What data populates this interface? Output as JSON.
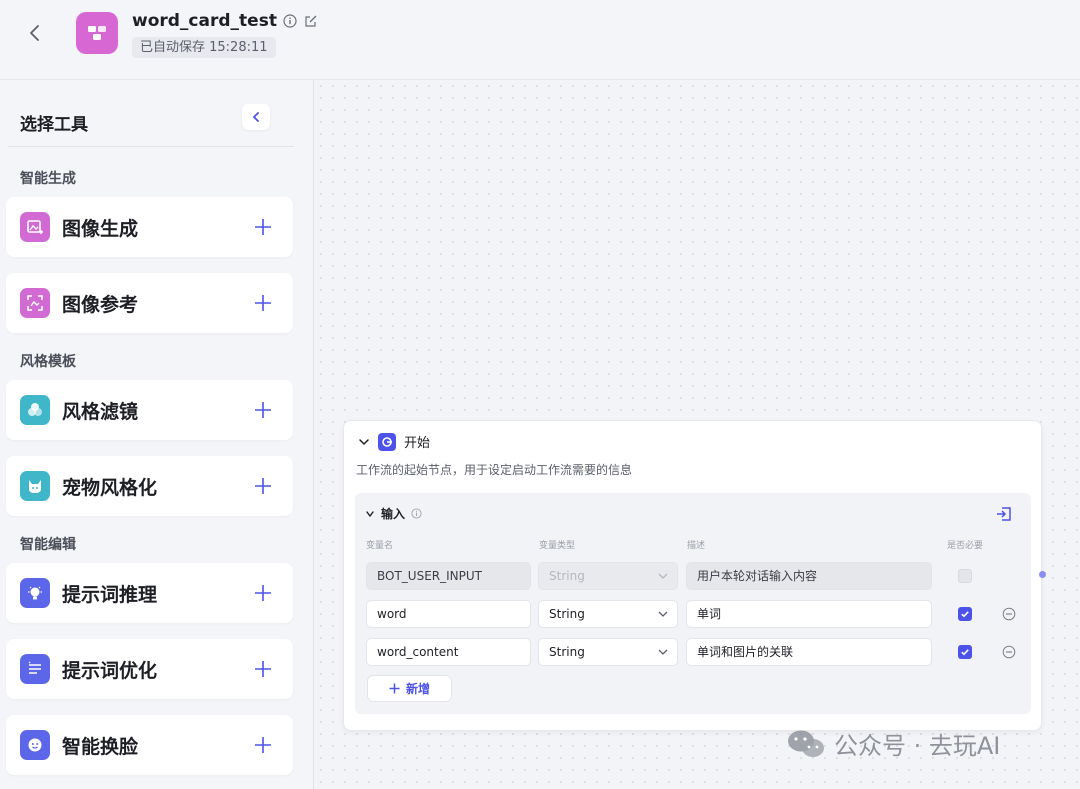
{
  "header": {
    "title": "word_card_test",
    "save_status": "已自动保存 15:28:11",
    "logo_color": "#d768d3"
  },
  "sidebar": {
    "title": "选择工具",
    "sections": [
      {
        "label": "智能生成"
      },
      {
        "label": "风格模板"
      },
      {
        "label": "智能编辑"
      }
    ],
    "tools": [
      {
        "label": "图像生成",
        "icon": "image-generate-icon",
        "color": "#d16ad2"
      },
      {
        "label": "图像参考",
        "icon": "image-reference-icon",
        "color": "#d16ad2"
      },
      {
        "label": "风格滤镜",
        "icon": "style-filter-icon",
        "color": "#3fb7c8"
      },
      {
        "label": "宠物风格化",
        "icon": "pet-cat-icon",
        "color": "#3fb7c8"
      },
      {
        "label": "提示词推理",
        "icon": "lightbulb-icon",
        "color": "#5b66e8"
      },
      {
        "label": "提示词优化",
        "icon": "prompt-optimize-icon",
        "color": "#5b66e8"
      },
      {
        "label": "智能换脸",
        "icon": "face-swap-icon",
        "color": "#5b66e8"
      }
    ]
  },
  "node": {
    "title": "开始",
    "description": "工作流的起始节点，用于设定启动工作流需要的信息",
    "inputs_title": "输入",
    "columns": {
      "name": "变量名",
      "type": "变量类型",
      "desc": "描述",
      "required": "是否必要"
    },
    "rows": [
      {
        "name": "BOT_USER_INPUT",
        "type": "String",
        "desc": "用户本轮对话输入内容",
        "required": false,
        "locked": true
      },
      {
        "name": "word",
        "type": "String",
        "desc": "单词",
        "required": true,
        "locked": false
      },
      {
        "name": "word_content",
        "type": "String",
        "desc": "单词和图片的关联",
        "required": true,
        "locked": false
      }
    ],
    "add_label": "新增",
    "accent": "#4d53e8"
  },
  "watermark": "公众号 · 去玩AI"
}
